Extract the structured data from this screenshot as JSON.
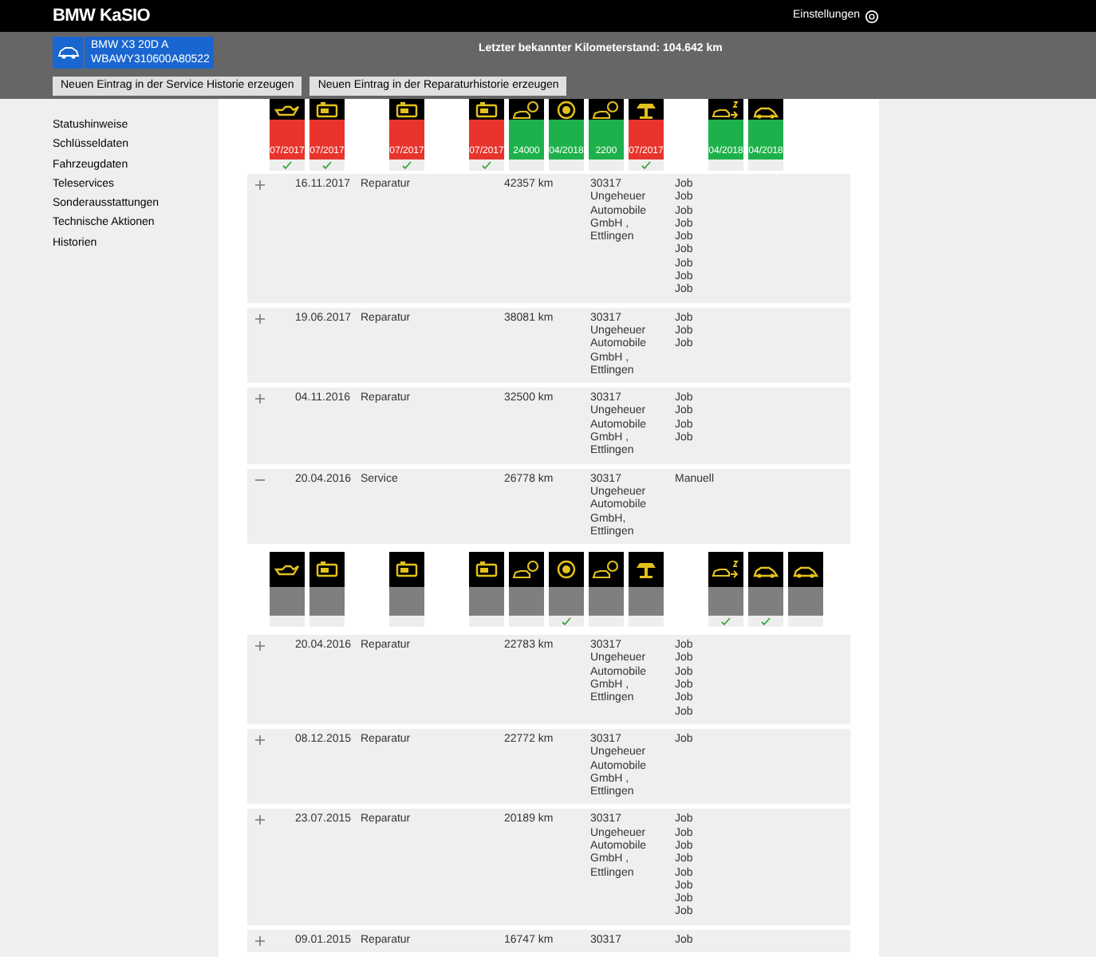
{
  "header": {
    "logo": "BMW KaSIO",
    "settings": "Einstellungen"
  },
  "vehicle": {
    "model": "BMW X3 20D A",
    "vin": "WBAWY310600A80522"
  },
  "mileage": "Letzter bekannter Kilometerstand: 104.642 km",
  "buttons": [
    "Neuen Eintrag in der Service Historie erzeugen",
    "Neuen Eintrag in der Reparaturhistorie erzeugen"
  ],
  "sidebar": {
    "items": [
      "Statushinweise",
      "Schlüsseldaten",
      "Fahrzeugdaten",
      "Teleservices",
      "Sonderausstattungen",
      "Technische Aktionen",
      "Historien"
    ]
  },
  "status_tiles": [
    {
      "kind": "oil",
      "color": "#e8342c",
      "text": "07/2017",
      "checked": true
    },
    {
      "kind": "battery",
      "color": "#e8342c",
      "text": "07/2017",
      "checked": true
    },
    {
      "kind": "blank"
    },
    {
      "kind": "battery",
      "color": "#e8342c",
      "text": "07/2017",
      "checked": true
    },
    {
      "kind": "blank"
    },
    {
      "kind": "battery",
      "color": "#e8342c",
      "text": "07/2017",
      "checked": true
    },
    {
      "kind": "car-brake",
      "color": "#1eb14b",
      "text": "24000",
      "checked": false
    },
    {
      "kind": "brake-disc",
      "color": "#1eb14b",
      "text": "04/2018",
      "checked": false
    },
    {
      "kind": "car-brake",
      "color": "#1eb14b",
      "text": "2200",
      "checked": false
    },
    {
      "kind": "car-lift",
      "color": "#e8342c",
      "text": "07/2017",
      "checked": true
    },
    {
      "kind": "blank"
    },
    {
      "kind": "car-arrow",
      "color": "#1eb14b",
      "text": "04/2018",
      "checked": false
    },
    {
      "kind": "car",
      "color": "#1eb14b",
      "text": "04/2018",
      "checked": false
    }
  ],
  "history": [
    {
      "expanded": false,
      "date": "16.11.2017",
      "type": "Reparatur",
      "km": "42357 km",
      "dealer": [
        "30317",
        "Ungeheuer",
        "Automobile",
        "GmbH ,",
        "Ettlingen"
      ],
      "jobs": [
        "Job",
        "Job",
        "Job",
        "Job",
        "Job",
        "Job",
        "Job",
        "Job",
        "Job"
      ]
    },
    {
      "expanded": false,
      "date": "19.06.2017",
      "type": "Reparatur",
      "km": "38081 km",
      "dealer": [
        "30317",
        "Ungeheuer",
        "Automobile",
        "GmbH ,",
        "Ettlingen"
      ],
      "jobs": [
        "Job",
        "Job",
        "Job"
      ]
    },
    {
      "expanded": false,
      "date": "04.11.2016",
      "type": "Reparatur",
      "km": "32500 km",
      "dealer": [
        "30317",
        "Ungeheuer",
        "Automobile",
        "GmbH ,",
        "Ettlingen"
      ],
      "jobs": [
        "Job",
        "Job",
        "Job",
        "Job"
      ]
    },
    {
      "expanded": true,
      "date": "20.04.2016",
      "type": "Service",
      "km": "26778 km",
      "dealer": [
        "30317",
        "Ungeheuer",
        "Automobile",
        "GmbH,",
        "Ettlingen"
      ],
      "jobs": [
        "Manuell"
      ],
      "tiles": [
        {
          "kind": "oil",
          "color": "#7f7f7f",
          "checked": false
        },
        {
          "kind": "battery",
          "color": "#7f7f7f",
          "checked": false
        },
        {
          "kind": "blank"
        },
        {
          "kind": "battery",
          "color": "#7f7f7f",
          "checked": false
        },
        {
          "kind": "blank"
        },
        {
          "kind": "battery",
          "color": "#7f7f7f",
          "checked": false
        },
        {
          "kind": "car-brake",
          "color": "#7f7f7f",
          "checked": false
        },
        {
          "kind": "brake-disc",
          "color": "#7f7f7f",
          "checked": true
        },
        {
          "kind": "car-brake",
          "color": "#7f7f7f",
          "checked": false
        },
        {
          "kind": "car-lift",
          "color": "#7f7f7f",
          "checked": false
        },
        {
          "kind": "blank"
        },
        {
          "kind": "car-arrow",
          "color": "#7f7f7f",
          "checked": true
        },
        {
          "kind": "car",
          "color": "#7f7f7f",
          "checked": true
        },
        {
          "kind": "car",
          "color": "#7f7f7f",
          "checked": false
        }
      ]
    },
    {
      "expanded": false,
      "date": "20.04.2016",
      "type": "Reparatur",
      "km": "22783 km",
      "dealer": [
        "30317",
        "Ungeheuer",
        "Automobile",
        "GmbH ,",
        "Ettlingen"
      ],
      "jobs": [
        "Job",
        "Job",
        "Job",
        "Job",
        "Job",
        "Job"
      ]
    },
    {
      "expanded": false,
      "date": "08.12.2015",
      "type": "Reparatur",
      "km": "22772 km",
      "dealer": [
        "30317",
        "Ungeheuer",
        "Automobile",
        "GmbH ,",
        "Ettlingen"
      ],
      "jobs": [
        "Job"
      ]
    },
    {
      "expanded": false,
      "date": "23.07.2015",
      "type": "Reparatur",
      "km": "20189 km",
      "dealer": [
        "30317",
        "Ungeheuer",
        "Automobile",
        "GmbH ,",
        "Ettlingen"
      ],
      "jobs": [
        "Job",
        "Job",
        "Job",
        "Job",
        "Job",
        "Job",
        "Job",
        "Job"
      ]
    },
    {
      "expanded": false,
      "date": "09.01.2015",
      "type": "Reparatur",
      "km": "16747 km",
      "dealer": [
        "30317"
      ],
      "jobs": [
        "Job"
      ]
    }
  ]
}
